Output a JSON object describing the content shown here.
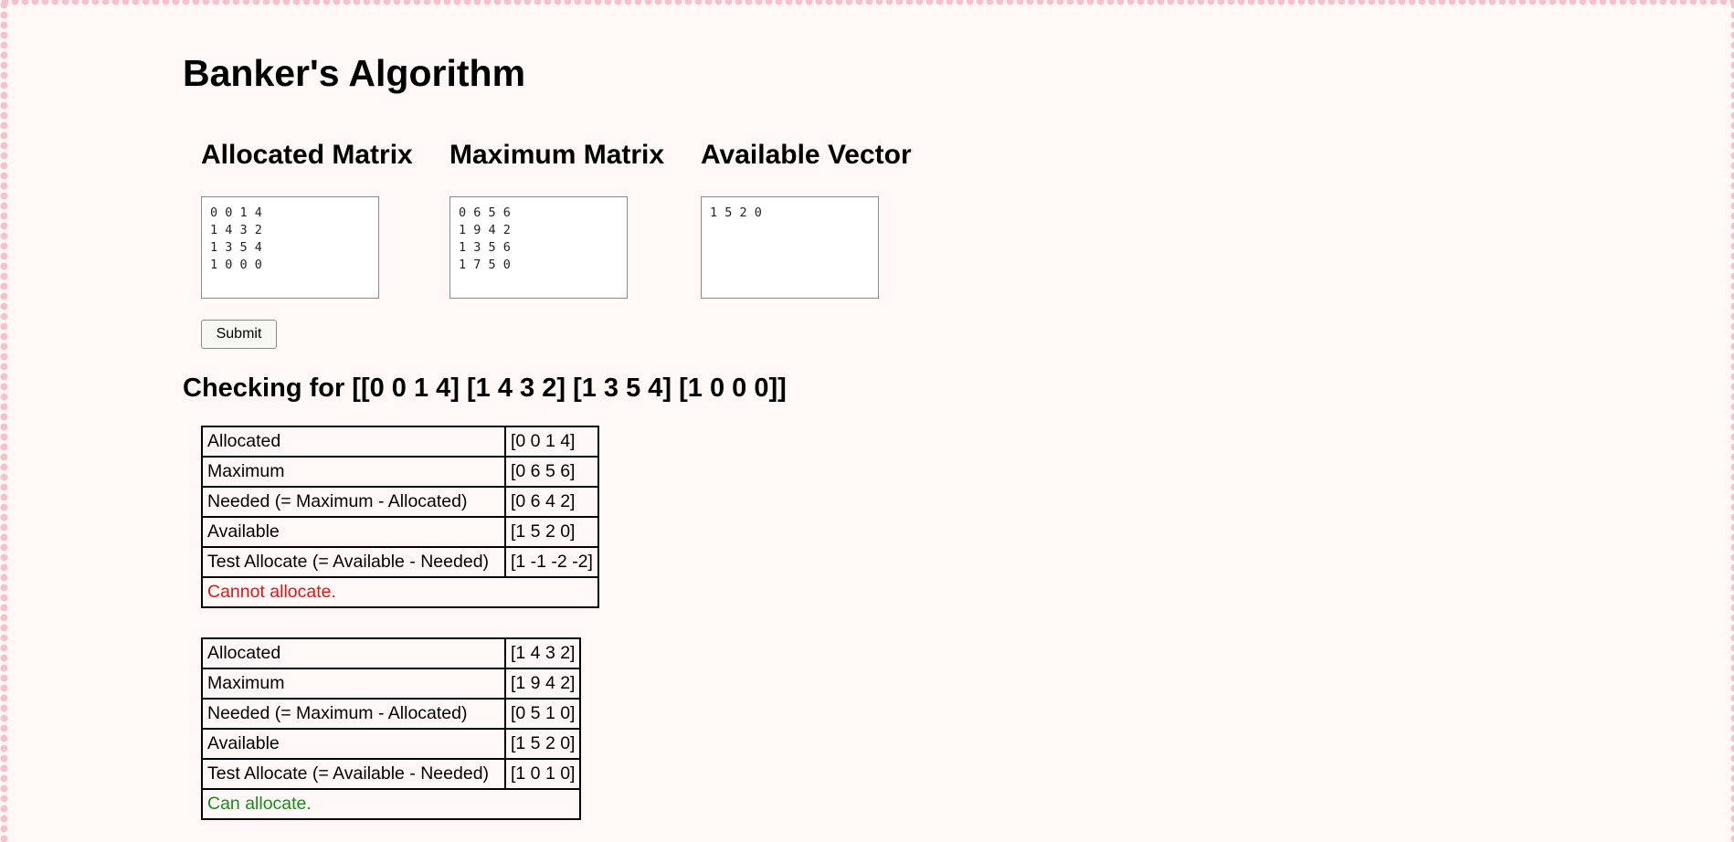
{
  "page": {
    "title": "Banker's Algorithm"
  },
  "inputs": {
    "allocated": {
      "heading": "Allocated Matrix",
      "value": "0 0 1 4\n1 4 3 2\n1 3 5 4\n1 0 0 0"
    },
    "maximum": {
      "heading": "Maximum Matrix",
      "value": "0 6 5 6\n1 9 4 2\n1 3 5 6\n1 7 5 0"
    },
    "available": {
      "heading": "Available Vector",
      "value": "1 5 2 0"
    }
  },
  "submit_label": "Submit",
  "checking": {
    "heading": "Checking for [[0 0 1 4] [1 4 3 2] [1 3 5 4] [1 0 0 0]]"
  },
  "steps": [
    {
      "rows": [
        {
          "label": "Allocated",
          "value": "[0 0 1 4]"
        },
        {
          "label": "Maximum",
          "value": "[0 6 5 6]"
        },
        {
          "label": "Needed (= Maximum - Allocated)",
          "value": "[0 6 4 2]"
        },
        {
          "label": "Available",
          "value": "[1 5 2 0]"
        },
        {
          "label": "Test Allocate (= Available - Needed)",
          "value": "[1 -1 -2 -2]"
        }
      ],
      "result": "Cannot allocate.",
      "result_color": "#d71818"
    },
    {
      "rows": [
        {
          "label": "Allocated",
          "value": "[1 4 3 2]"
        },
        {
          "label": "Maximum",
          "value": "[1 9 4 2]"
        },
        {
          "label": "Needed (= Maximum - Allocated)",
          "value": "[0 5 1 0]"
        },
        {
          "label": "Available",
          "value": "[1 5 2 0]"
        },
        {
          "label": "Test Allocate (= Available - Needed)",
          "value": "[1 0 1 0]"
        }
      ],
      "result": "Can allocate.",
      "result_color": "#1a8a1a"
    }
  ],
  "colors": {
    "background": "#fff8f7",
    "border_dots": "#f7c1cb"
  }
}
